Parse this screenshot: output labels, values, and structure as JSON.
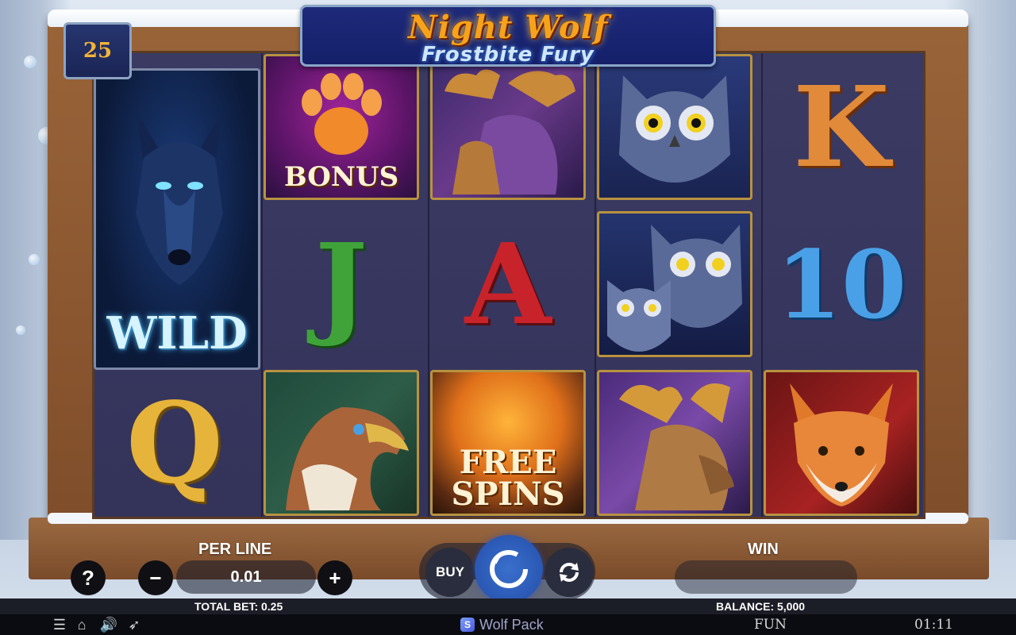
{
  "game": {
    "title": "Night Wolf",
    "subtitle": "Frostbite Fury",
    "lines": "25"
  },
  "reels": {
    "wild_label": "WILD",
    "bonus_label": "BONUS",
    "free_spins_line1": "FREE",
    "free_spins_line2": "SPINS",
    "letters": {
      "k": "K",
      "j": "J",
      "a": "A",
      "q": "Q",
      "ten": "10"
    }
  },
  "controls": {
    "help_label": "?",
    "per_line_label": "PER LINE",
    "minus_label": "−",
    "plus_label": "+",
    "bet_value": "0.01",
    "buy_label": "BUY",
    "win_label": "WIN",
    "win_value": "",
    "total_bet": "TOTAL BET: 0.25",
    "balance": "BALANCE: 5,000"
  },
  "footer": {
    "brand": "Wolf Pack",
    "mode": "FUN",
    "clock": "01:11",
    "icons": [
      "menu-icon",
      "home-icon",
      "sound-icon",
      "turbo-icon"
    ]
  },
  "colors": {
    "spin_button": "#2a58b4",
    "frame_wood": "#8a5530",
    "reel_bg": "#3a3a63",
    "logo_gold": "#f6a21a"
  }
}
